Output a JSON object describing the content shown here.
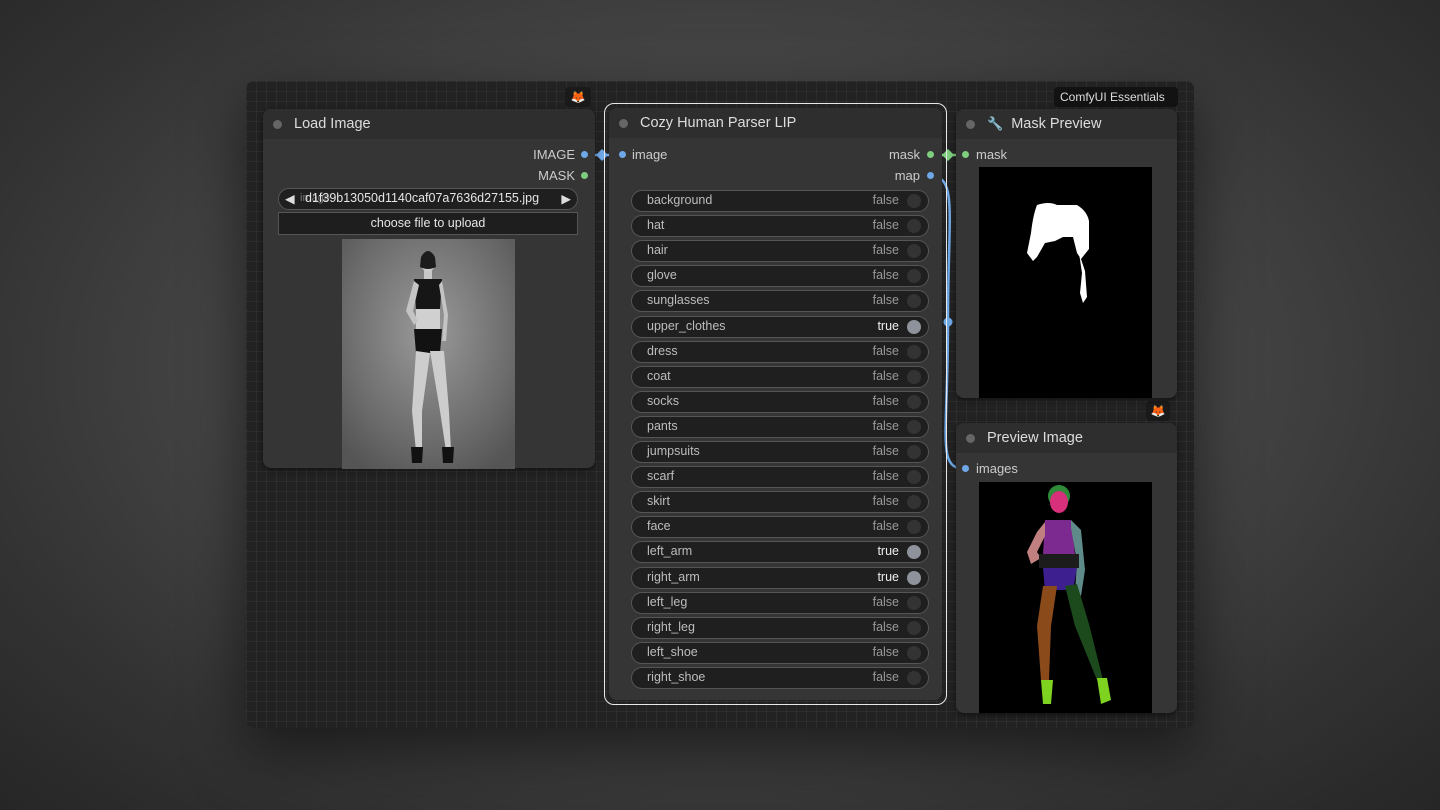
{
  "badges": {
    "fox": "🦊",
    "essentials": "ComfyUI Essentials"
  },
  "load_image": {
    "title": "Load Image",
    "outputs": [
      "IMAGE",
      "MASK"
    ],
    "filename": "d1f39b13050d1140caf07a7636d27155.jpg",
    "filename_label": "image",
    "upload_label": "choose file to upload"
  },
  "parser": {
    "title": "Cozy Human Parser LIP",
    "input": "image",
    "outputs": [
      "mask",
      "map"
    ],
    "toggles": [
      {
        "label": "background",
        "value": "false"
      },
      {
        "label": "hat",
        "value": "false"
      },
      {
        "label": "hair",
        "value": "false"
      },
      {
        "label": "glove",
        "value": "false"
      },
      {
        "label": "sunglasses",
        "value": "false"
      },
      {
        "label": "upper_clothes",
        "value": "true"
      },
      {
        "label": "dress",
        "value": "false"
      },
      {
        "label": "coat",
        "value": "false"
      },
      {
        "label": "socks",
        "value": "false"
      },
      {
        "label": "pants",
        "value": "false"
      },
      {
        "label": "jumpsuits",
        "value": "false"
      },
      {
        "label": "scarf",
        "value": "false"
      },
      {
        "label": "skirt",
        "value": "false"
      },
      {
        "label": "face",
        "value": "false"
      },
      {
        "label": "left_arm",
        "value": "true"
      },
      {
        "label": "right_arm",
        "value": "true"
      },
      {
        "label": "left_leg",
        "value": "false"
      },
      {
        "label": "right_leg",
        "value": "false"
      },
      {
        "label": "left_shoe",
        "value": "false"
      },
      {
        "label": "right_shoe",
        "value": "false"
      }
    ]
  },
  "mask_preview": {
    "title": "Mask Preview",
    "input": "mask",
    "icon": "wrench-icon"
  },
  "preview_image": {
    "title": "Preview Image",
    "input": "images"
  },
  "colors": {
    "blue_link": "#6fa8e6",
    "green_link": "#7fce7f",
    "toggle_on": "#8e929a",
    "selected_border": "#e8e8e8"
  }
}
